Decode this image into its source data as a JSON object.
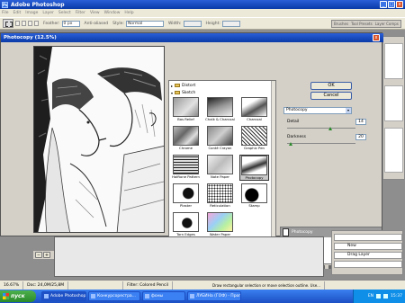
{
  "app": {
    "title": "Adobe Photoshop",
    "icon": "photoshop-icon",
    "controls": [
      "_",
      "□",
      "x"
    ]
  },
  "menu": [
    "File",
    "Edit",
    "Image",
    "Layer",
    "Select",
    "Filter",
    "View",
    "Window",
    "Help"
  ],
  "options": {
    "feather_label": "Feather:",
    "feather_value": "0 px",
    "antialias_label": "Anti-aliased",
    "style_label": "Style:",
    "style_value": "Normal",
    "width_label": "Width:",
    "height_label": "Height:",
    "right_tabs": [
      "Brushes",
      "Tool Presets",
      "Layer Comps"
    ]
  },
  "dialog": {
    "title": "Photocopy (12.5%)",
    "zoom": "12.5%",
    "categories": {
      "distort": "Distort",
      "sketch": "Sketch"
    },
    "thumbnails": [
      "Bas Relief",
      "Chalk & Charcoal",
      "Charcoal",
      "Chrome",
      "Conté Crayon",
      "Graphic Pen",
      "Halftone Pattern",
      "Note Paper",
      "Photocopy",
      "Plaster",
      "Reticulation",
      "Stamp",
      "Torn Edges",
      "Water Paper"
    ],
    "selected_thumbnail": "Photocopy",
    "ok_label": "OK",
    "cancel_label": "Cancel",
    "filter_select": "Photocopy",
    "detail_label": "Detail",
    "detail_value": "14",
    "darkness_label": "Darkness",
    "darkness_value": "20",
    "effect_layer": "Photocopy"
  },
  "layers_panel": {
    "items": [
      "New",
      "Drag Layer"
    ]
  },
  "status": {
    "zoom": "16.67%",
    "doc": "Doc: 24,0M/25,8M",
    "filter": "Filter: Colored Pencil",
    "hint": "Draw rectangular selection or move selection outline. Use..."
  },
  "taskbar": {
    "start": "пуск",
    "tasks": [
      "Adobe Photoshop",
      "Конкурсорестра...",
      "фоны",
      "ЛУБИНа (ГОФ) - Прог..."
    ],
    "lang": "EN",
    "clock": "15:37"
  },
  "colors": {
    "titlebar": "#0a3aa8",
    "workspace": "#8e8e8e",
    "panel": "#d4d0c8",
    "taskbar": "#1c4fc4",
    "start": "#2a8a2a"
  }
}
